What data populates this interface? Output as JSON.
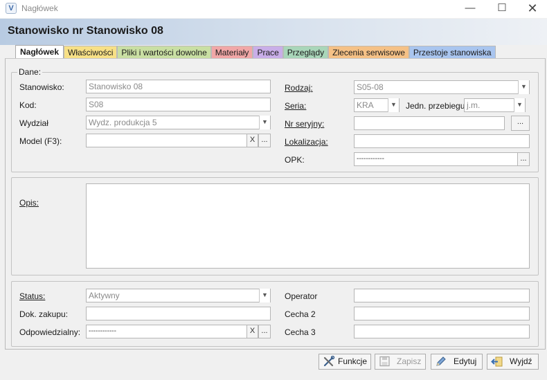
{
  "window": {
    "icon_letter": "V",
    "title": "Nagłówek",
    "minimize": "—",
    "maximize": "☐",
    "close": "✕"
  },
  "header": {
    "title": "Stanowisko nr Stanowisko 08"
  },
  "tabs": [
    {
      "label": "Nagłówek",
      "color": "#ffffff"
    },
    {
      "label": "Właściwości",
      "color": "#f7e086"
    },
    {
      "label": "Pliki i wartości dowolne",
      "color": "#c9dfa3"
    },
    {
      "label": "Materiały",
      "color": "#f1a7a7"
    },
    {
      "label": "Prace",
      "color": "#c9aee8"
    },
    {
      "label": "Przeglądy",
      "color": "#a9d6b9"
    },
    {
      "label": "Zlecenia serwisowe",
      "color": "#f5c186"
    },
    {
      "label": "Przestoje stanowiska",
      "color": "#a9c5ef"
    }
  ],
  "dane": {
    "title": "Dane:",
    "stanowisko": {
      "label": "Stanowisko:",
      "value": "Stanowisko 08"
    },
    "kod": {
      "label": "Kod:",
      "value": "S08"
    },
    "wydzial": {
      "label": "Wydział",
      "value": "Wydz. produkcja 5"
    },
    "model": {
      "label": "Model (F3):",
      "value": "",
      "clear": "X",
      "more": "..."
    },
    "rodzaj": {
      "label": "Rodzaj:",
      "value": "S05-08"
    },
    "seria": {
      "label": "Seria:",
      "value": "KRA"
    },
    "jedn": {
      "label": "Jedn. przebiegu:",
      "value": "j.m."
    },
    "nr_seryjny": {
      "label": "Nr seryjny:",
      "value": "",
      "more": "..."
    },
    "lokalizacja": {
      "label": "Lokalizacja:",
      "value": ""
    },
    "opk": {
      "label": "OPK:",
      "value": "------------",
      "more": "..."
    }
  },
  "opis": {
    "label": "Opis:",
    "value": ""
  },
  "bottom": {
    "status": {
      "label": "Status:",
      "value": "Aktywny"
    },
    "dok_zakupu": {
      "label": "Dok. zakupu:",
      "value": ""
    },
    "odpowiedzialny": {
      "label": "Odpowiedzialny:",
      "value": "------------",
      "clear": "X",
      "more": "..."
    },
    "operator": {
      "label": "Operator",
      "value": ""
    },
    "cecha2": {
      "label": "Cecha 2",
      "value": ""
    },
    "cecha3": {
      "label": "Cecha 3",
      "value": ""
    }
  },
  "footer": {
    "funkcje": "Funkcje",
    "zapisz": "Zapisz",
    "edytuj": "Edytuj",
    "wyjdz": "Wyjdź"
  }
}
